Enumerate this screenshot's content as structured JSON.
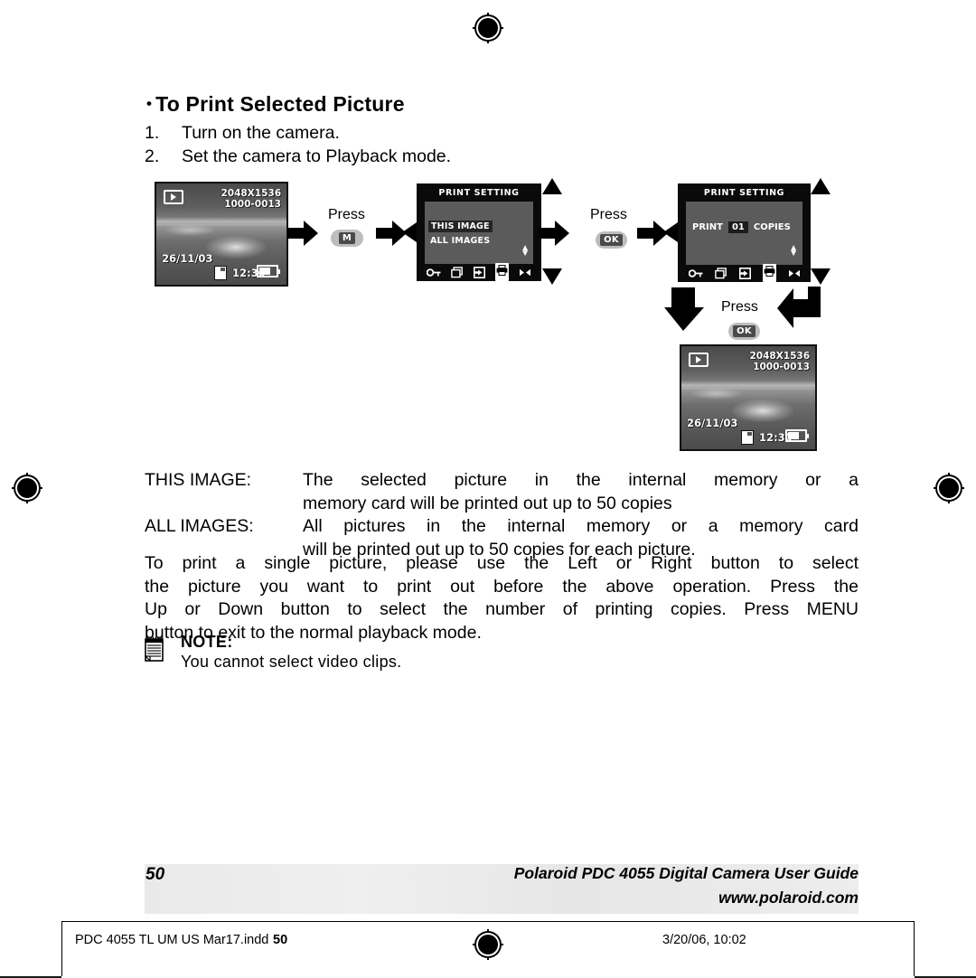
{
  "heading": {
    "bullet": "•",
    "text": "To Print Selected Picture"
  },
  "steps": [
    {
      "num": "1.",
      "text": "Turn on the camera."
    },
    {
      "num": "2.",
      "text": "Set the camera to Playback mode."
    }
  ],
  "figure": {
    "screen1": {
      "name": "playback-photo-screen",
      "resolution": "2048X1536",
      "file_number": "1000-0013",
      "date": "26/11/03",
      "time": "12:30",
      "mode_icon": "playback-icon",
      "card_icon": "memory-card-icon",
      "battery_icon": "battery-icon"
    },
    "press1": {
      "label": "Press",
      "button": "M"
    },
    "screen2": {
      "name": "print-setting-menu",
      "title": "PRINT SETTING",
      "options": [
        {
          "label": "THIS IMAGE",
          "selected": true
        },
        {
          "label": "ALL IMAGES",
          "selected": false
        }
      ],
      "icons": [
        "key-icon",
        "copy-icon",
        "transfer-icon",
        "printer-icon",
        "leftright-icon"
      ],
      "active_icon": "printer-icon"
    },
    "press2": {
      "label": "Press",
      "button": "OK"
    },
    "screen3": {
      "name": "print-copies-menu",
      "title": "PRINT SETTING",
      "print_label": "PRINT",
      "copies_value": "01",
      "copies_label": "COPIES",
      "icons": [
        "key-icon",
        "copy-icon",
        "transfer-icon",
        "printer-icon",
        "leftright-icon"
      ],
      "active_icon": "printer-icon"
    },
    "press3": {
      "label": "Press",
      "button": "OK"
    },
    "screen4": {
      "name": "playback-photo-screen-result",
      "resolution": "2048X1536",
      "file_number": "1000-0013",
      "date": "26/11/03",
      "time": "12:30",
      "mode_icon": "playback-icon",
      "card_icon": "memory-card-icon",
      "battery_icon": "battery-icon"
    }
  },
  "definitions": [
    {
      "term": "THIS IMAGE:",
      "line1": "The selected picture in the internal memory or a",
      "line2": "memory card will be printed out up to 50 copies"
    },
    {
      "term": "ALL IMAGES:",
      "line1": "All pictures in the internal memory or a memory card",
      "line2": "will be printed out up to 50 copies for each picture."
    }
  ],
  "paragraph": {
    "line1": "To print a single picture, please use the Left or Right button to select",
    "line2": "the picture you want to print out before the above operation. Press the",
    "line3": "Up or Down button to select the number of printing copies. Press MENU",
    "line4": "button to exit to the normal playback mode."
  },
  "note": {
    "icon": "notepad-icon",
    "title": "NOTE:",
    "body": "You cannot select video clips."
  },
  "footer": {
    "page_number": "50",
    "title": "Polaroid PDC 4055 Digital Camera User Guide",
    "url": "www.polaroid.com"
  },
  "imprint": {
    "left": "PDC 4055 TL UM US Mar17.indd",
    "overlay_page": "50",
    "right": "3/20/06, 10:02",
    "registration_icon": "registration-mark-icon"
  },
  "colors": {
    "ink": "#000000",
    "paper": "#ffffff",
    "lcd_black": "#0a0a0a",
    "lcd_panel": "#5b5b5b",
    "footer_band": "#e9e9e9"
  }
}
